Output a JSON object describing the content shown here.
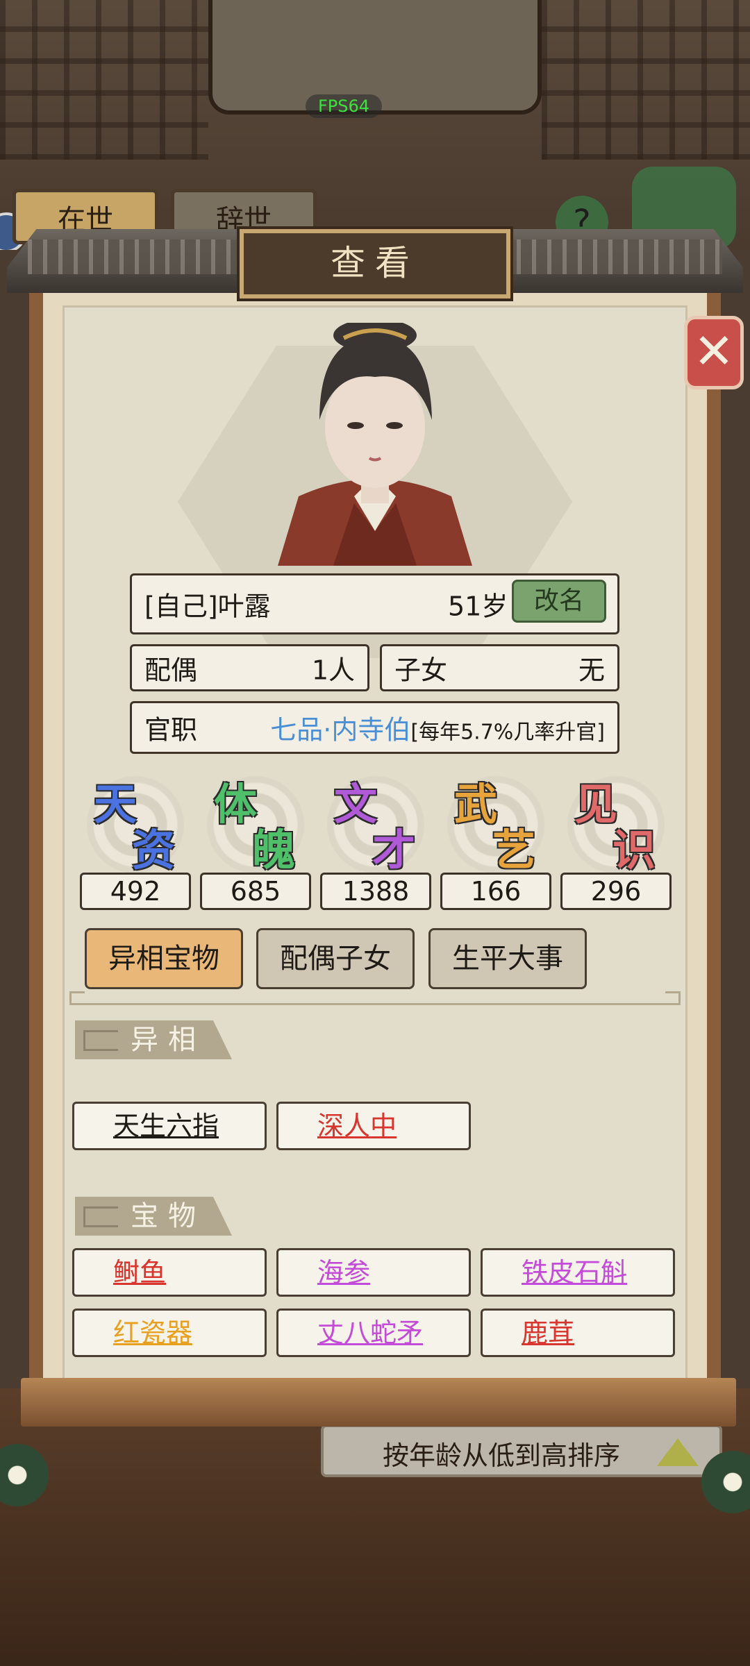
{
  "background": {
    "fps": "FPS64",
    "tabs": [
      {
        "label": "在世"
      },
      {
        "label": "辞世"
      }
    ],
    "help_symbol": "?",
    "sort_label": "按年龄从低到高排序"
  },
  "dialog": {
    "title": "查看",
    "close_icon": "close-x-icon"
  },
  "profile": {
    "name": "[自己]叶露",
    "age": "51岁",
    "rename_label": "改名",
    "spouse_label": "配偶",
    "spouse_value": "1人",
    "children_label": "子女",
    "children_value": "无",
    "official_label": "官职",
    "official_rank": "七品·内寺伯",
    "official_note": "[每年5.7%几率升官]"
  },
  "attributes": [
    {
      "c1": "天",
      "c2": "资",
      "value": "492",
      "color": "#4a72e0"
    },
    {
      "c1": "体",
      "c2": "魄",
      "value": "685",
      "color": "#4fbf6a"
    },
    {
      "c1": "文",
      "c2": "才",
      "value": "1388",
      "color": "#b05ad8"
    },
    {
      "c1": "武",
      "c2": "艺",
      "value": "166",
      "color": "#e8a43c"
    },
    {
      "c1": "见",
      "c2": "识",
      "value": "296",
      "color": "#e06a6a"
    }
  ],
  "tabs": [
    {
      "label": "异相宝物",
      "active": true
    },
    {
      "label": "配偶子女",
      "active": false
    },
    {
      "label": "生平大事",
      "active": false
    }
  ],
  "traits": {
    "title": "异相",
    "items": [
      {
        "label": "天生六指",
        "color": "#1e1a16"
      },
      {
        "label": "深人中",
        "color": "#d8352f"
      }
    ]
  },
  "treasures": {
    "title": "宝物",
    "items": [
      {
        "label": "鲥鱼",
        "color": "#d8352f"
      },
      {
        "label": "海参",
        "color": "#c44ad8"
      },
      {
        "label": "铁皮石斛",
        "color": "#c44ad8"
      },
      {
        "label": "红瓷器",
        "color": "#e8a020"
      },
      {
        "label": "丈八蛇矛",
        "color": "#c44ad8"
      },
      {
        "label": "鹿茸",
        "color": "#d8352f"
      }
    ]
  }
}
